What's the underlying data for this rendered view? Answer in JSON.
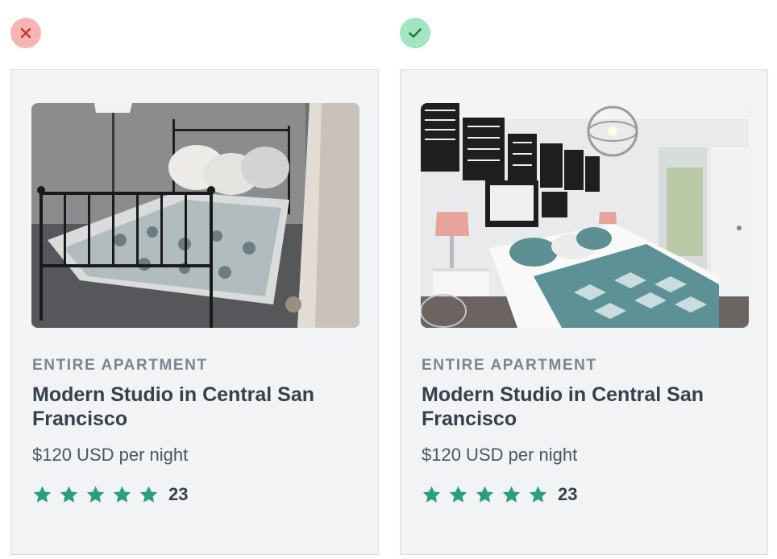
{
  "examples": [
    {
      "verdict": "incorrect",
      "badge_icon": "x-icon",
      "badge_color": "#f8b4b4",
      "image": "dim-bedroom-photo",
      "listing": {
        "type": "ENTIRE APARTMENT",
        "title": "Modern Studio in Central San Francisco",
        "price": "$120 USD per night",
        "rating_stars": 5,
        "review_count": "23"
      }
    },
    {
      "verdict": "correct",
      "badge_icon": "check-icon",
      "badge_color": "#a3e4c1",
      "image": "bright-bedroom-photo",
      "listing": {
        "type": "ENTIRE APARTMENT",
        "title": "Modern Studio in Central San Francisco",
        "price": "$120 USD per night",
        "rating_stars": 5,
        "review_count": "23"
      }
    }
  ],
  "colors": {
    "star": "#2a9d82",
    "card_bg": "#f2f3f5",
    "title": "#36404d",
    "eyebrow": "#7a8593"
  }
}
